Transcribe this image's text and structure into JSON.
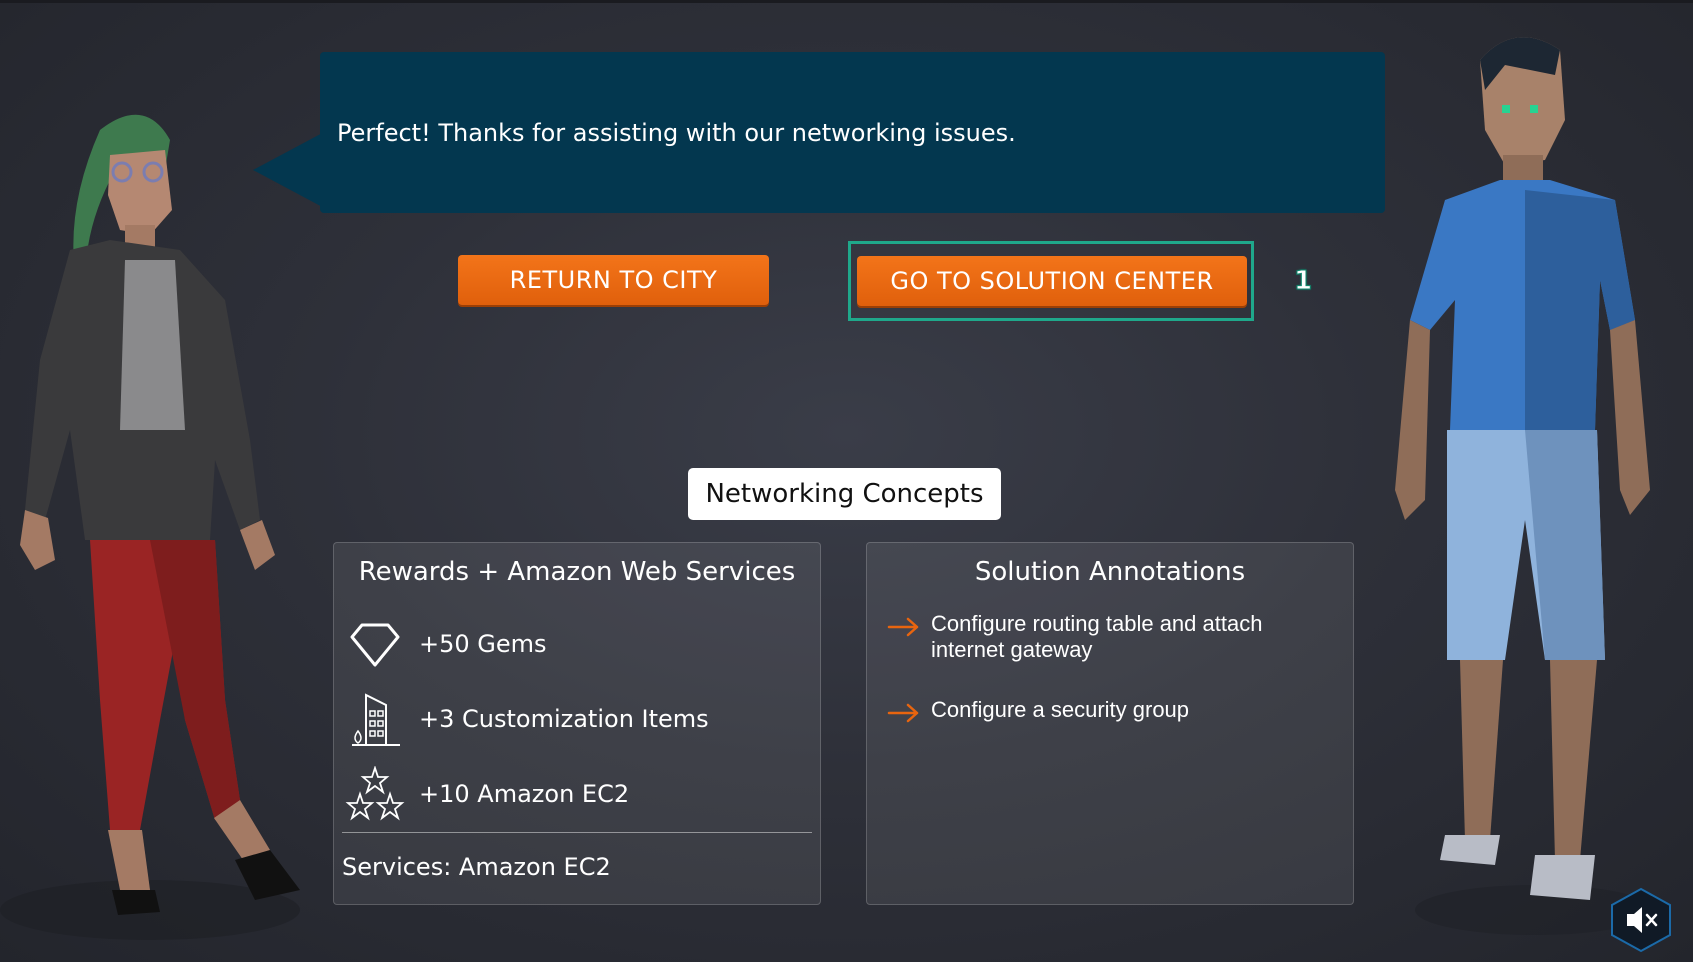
{
  "dialog": {
    "message": "Perfect! Thanks for assisting with our networking issues."
  },
  "buttons": {
    "return_label": "RETURN TO CITY",
    "solution_label": "GO TO SOLUTION CENTER"
  },
  "marker": {
    "label": "1"
  },
  "concepts_tag": "Networking Concepts",
  "rewards": {
    "title": "Rewards + Amazon Web Services",
    "items": [
      {
        "icon": "diamond-icon",
        "label": "+50 Gems"
      },
      {
        "icon": "building-icon",
        "label": "+3 Customization Items"
      },
      {
        "icon": "stars-icon",
        "label": "+10 Amazon EC2"
      }
    ],
    "services": "Services: Amazon EC2"
  },
  "annotations": {
    "title": "Solution Annotations",
    "items": [
      {
        "icon": "arrow-right-icon",
        "label": "Configure routing table and attach internet gateway"
      },
      {
        "icon": "arrow-right-icon",
        "label": "Configure a security group"
      }
    ]
  },
  "colors": {
    "bubble": "#03374f",
    "button": "#e8650f",
    "focus_ring": "#1fa88b",
    "arrow": "#e8650f",
    "background": "#2e3039"
  },
  "sound_button": {
    "icon": "speaker-muted-icon"
  }
}
